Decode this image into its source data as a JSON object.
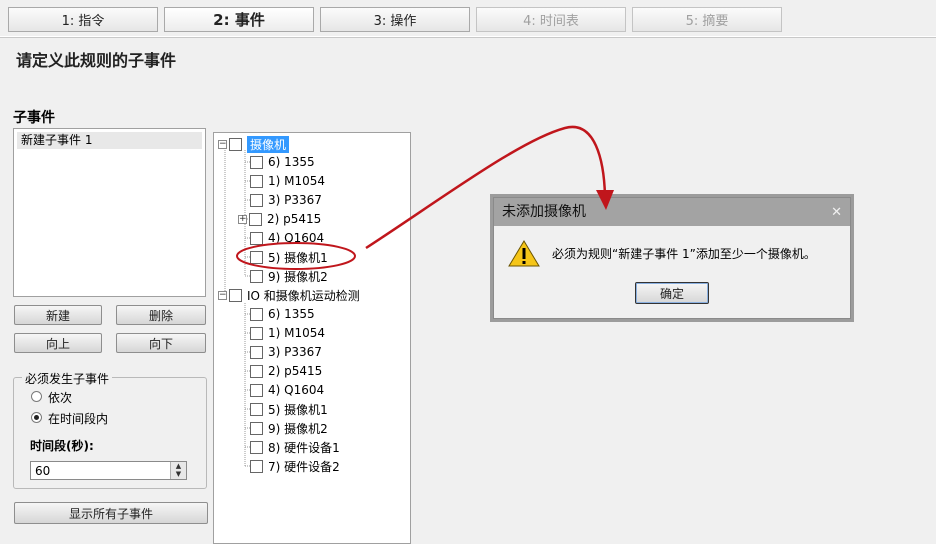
{
  "steps": [
    {
      "label": "1: 指令"
    },
    {
      "label": "2: 事件"
    },
    {
      "label": "3: 操作"
    },
    {
      "label": "4: 时间表"
    },
    {
      "label": "5: 摘要"
    }
  ],
  "page_title": "请定义此规则的子事件",
  "subevents": {
    "label": "子事件",
    "items": [
      "新建子事件 1"
    ]
  },
  "buttons": {
    "new": "新建",
    "delete": "删除",
    "up": "向上",
    "down": "向下",
    "show_all": "显示所有子事件"
  },
  "must_occur": {
    "legend": "必须发生子事件",
    "option_sequence": "依次",
    "option_period": "在时间段内",
    "selected": "在时间段内",
    "period_label": "时间段(秒):",
    "period_value": "60"
  },
  "tree": {
    "group1": {
      "label": "摄像机",
      "items": [
        "6) 1355",
        "1) M1054",
        "3) P3367",
        "2) p5415",
        "4) Q1604",
        "5) 摄像机1",
        "9) 摄像机2"
      ]
    },
    "group2": {
      "label": "IO 和摄像机运动检测",
      "items": [
        "6) 1355",
        "1) M1054",
        "3) P3367",
        "2) p5415",
        "4) Q1604",
        "5) 摄像机1",
        "9) 摄像机2",
        "8) 硬件设备1",
        "7) 硬件设备2"
      ]
    }
  },
  "dialog": {
    "title": "未添加摄像机",
    "message": "必须为规则“新建子事件 1”添加至少一个摄像机。",
    "ok": "确定"
  },
  "colors": {
    "annotation": "#c0161c",
    "selection": "#3399ff",
    "dialog_title_bg": "#a3a3a3"
  }
}
